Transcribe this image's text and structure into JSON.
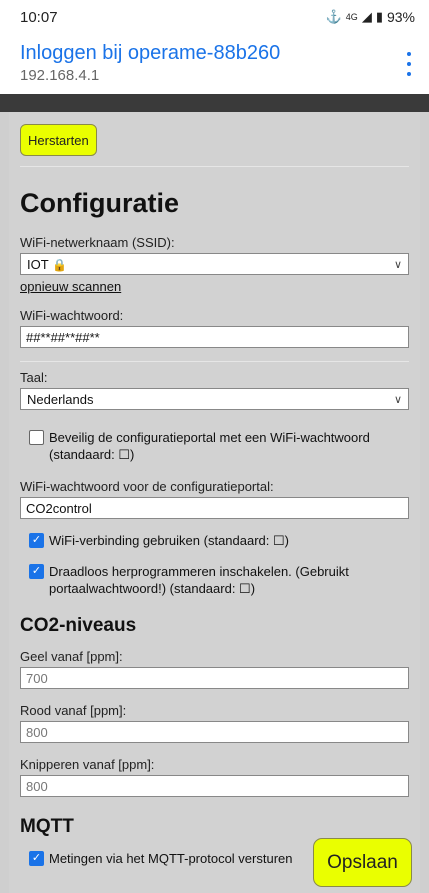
{
  "statusbar": {
    "time": "10:07",
    "network": "4G",
    "battery": "93%"
  },
  "appbar": {
    "title": "Inloggen bij operame-88b260",
    "subtitle": "192.168.4.1"
  },
  "restart_label": "Herstarten",
  "config": {
    "title": "Configuratie",
    "ssid_label": "WiFi-netwerknaam (SSID):",
    "ssid_value": "IOT",
    "rescan_label": "opnieuw scannen",
    "wifi_password_label": "WiFi-wachtwoord:",
    "wifi_password_value": "##**##**##**",
    "language_label": "Taal:",
    "language_value": "Nederlands",
    "protect_portal_label": "Beveilig de configuratieportal met een WiFi-wachtwoord (standaard: ☐)",
    "protect_portal_checked": false,
    "portal_password_label": "WiFi-wachtwoord voor de configuratieportal:",
    "portal_password_value": "CO2control",
    "use_wifi_label": "WiFi-verbinding gebruiken (standaard: ☐)",
    "use_wifi_checked": true,
    "ota_label": "Draadloos herprogrammeren inschakelen. (Gebruikt portaalwachtwoord!) (standaard: ☐)",
    "ota_checked": true
  },
  "co2": {
    "title": "CO2-niveaus",
    "yellow_label": "Geel vanaf [ppm]:",
    "yellow_value": "700",
    "red_label": "Rood vanaf [ppm]:",
    "red_value": "800",
    "blink_label": "Knipperen vanaf [ppm]:",
    "blink_value": "800"
  },
  "mqtt": {
    "title": "MQTT",
    "publish_label": "Metingen via het MQTT-protocol versturen",
    "publish_checked": true
  },
  "save_label": "Opslaan",
  "colors": {
    "accent": "#1a73e8",
    "button_yellow": "#eaff00"
  }
}
